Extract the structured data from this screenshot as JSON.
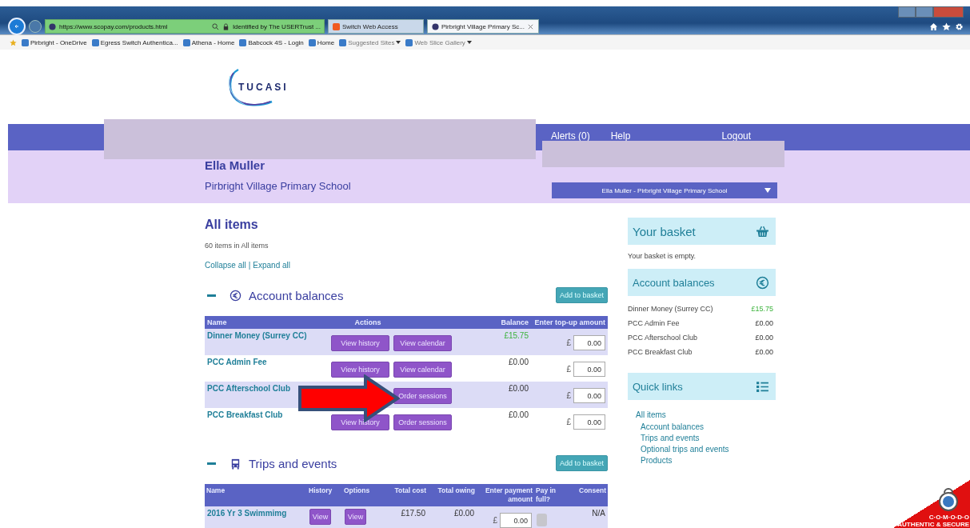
{
  "browser": {
    "address": "https://www.scopay.com/products.html",
    "identity": "Identified by The USERTrust ...",
    "tabs": [
      {
        "label": "Switch Web Access",
        "selected": false
      },
      {
        "label": "Pirbright Village Primary Sc...",
        "selected": true
      }
    ],
    "favorites": [
      {
        "label": "Pirbright - OneDrive",
        "dropdown": false
      },
      {
        "label": "Egress Switch  Authentica...",
        "dropdown": false
      },
      {
        "label": "Athena - Home",
        "dropdown": false
      },
      {
        "label": "Babcock 4S - Login",
        "dropdown": false
      },
      {
        "label": "Home",
        "dropdown": false
      },
      {
        "label": "Suggested Sites",
        "dropdown": true
      },
      {
        "label": "Web Slice Gallery",
        "dropdown": true
      }
    ]
  },
  "logo": "TUCASI",
  "header": {
    "nav": [
      "Alerts (0)",
      "Help",
      "Logout"
    ],
    "user_name": "Ella Muller",
    "school": "Pirbright Village Primary School",
    "account_select": "Ella Muller - Pirbright Village Primary School"
  },
  "main": {
    "title": "All items",
    "count": "60 items in All items",
    "collapse": "Collapse all",
    "separator": "|",
    "expand": "Expand all"
  },
  "account_balances": {
    "title": "Account balances",
    "add_button": "Add to basket",
    "columns": [
      "Name",
      "Actions",
      "Balance",
      "Enter top-up amount"
    ],
    "rows": [
      {
        "name": "Dinner Money (Surrey CC)",
        "actions": [
          "View history",
          "View calendar"
        ],
        "balance": "£15.75",
        "positive": true,
        "currency": "£",
        "amount": "0.00"
      },
      {
        "name": "PCC Admin Fee",
        "actions": [
          "View history",
          "View calendar"
        ],
        "balance": "£0.00",
        "positive": false,
        "currency": "£",
        "amount": "0.00"
      },
      {
        "name": "PCC Afterschool Club",
        "actions": [
          "Order sessions"
        ],
        "balance": "£0.00",
        "positive": false,
        "currency": "£",
        "amount": "0.00"
      },
      {
        "name": "PCC Breakfast Club",
        "actions": [
          "View history",
          "Order sessions"
        ],
        "balance": "£0.00",
        "positive": false,
        "currency": "£",
        "amount": "0.00"
      }
    ]
  },
  "trips": {
    "title": "Trips and events",
    "add_button": "Add to basket",
    "columns": [
      "Name",
      "History",
      "Options",
      "Total cost",
      "Total owing",
      "Enter payment amount",
      "Pay in full?",
      "Consent"
    ],
    "rows": [
      {
        "name": "2016 Yr 3 Swimmimg",
        "history": "View",
        "options": "View",
        "total_cost": "£17.50",
        "total_owing": "£0.00",
        "currency": "£",
        "amount": "0.00",
        "pay_in_full": false,
        "consent": "N/A"
      }
    ]
  },
  "sidebar": {
    "basket_title": "Your basket",
    "basket_text": "Your basket is empty.",
    "balances_title": "Account balances",
    "balances": [
      {
        "name": "Dinner Money (Surrey CC)",
        "amount": "£15.75",
        "positive": true
      },
      {
        "name": "PCC Admin Fee",
        "amount": "£0.00",
        "positive": false
      },
      {
        "name": "PCC Afterschool Club",
        "amount": "£0.00",
        "positive": false
      },
      {
        "name": "PCC Breakfast Club",
        "amount": "£0.00",
        "positive": false
      }
    ],
    "links_title": "Quick links",
    "links": [
      {
        "label": "All items",
        "children": [
          {
            "label": "Account balances"
          },
          {
            "label": "Trips and events"
          },
          {
            "label": "Optional trips and events"
          },
          {
            "label": "Products"
          }
        ]
      }
    ]
  },
  "seal": {
    "brand": "C·O·M·O·D·O",
    "tagline": "AUTHENTIC & SECURE"
  }
}
